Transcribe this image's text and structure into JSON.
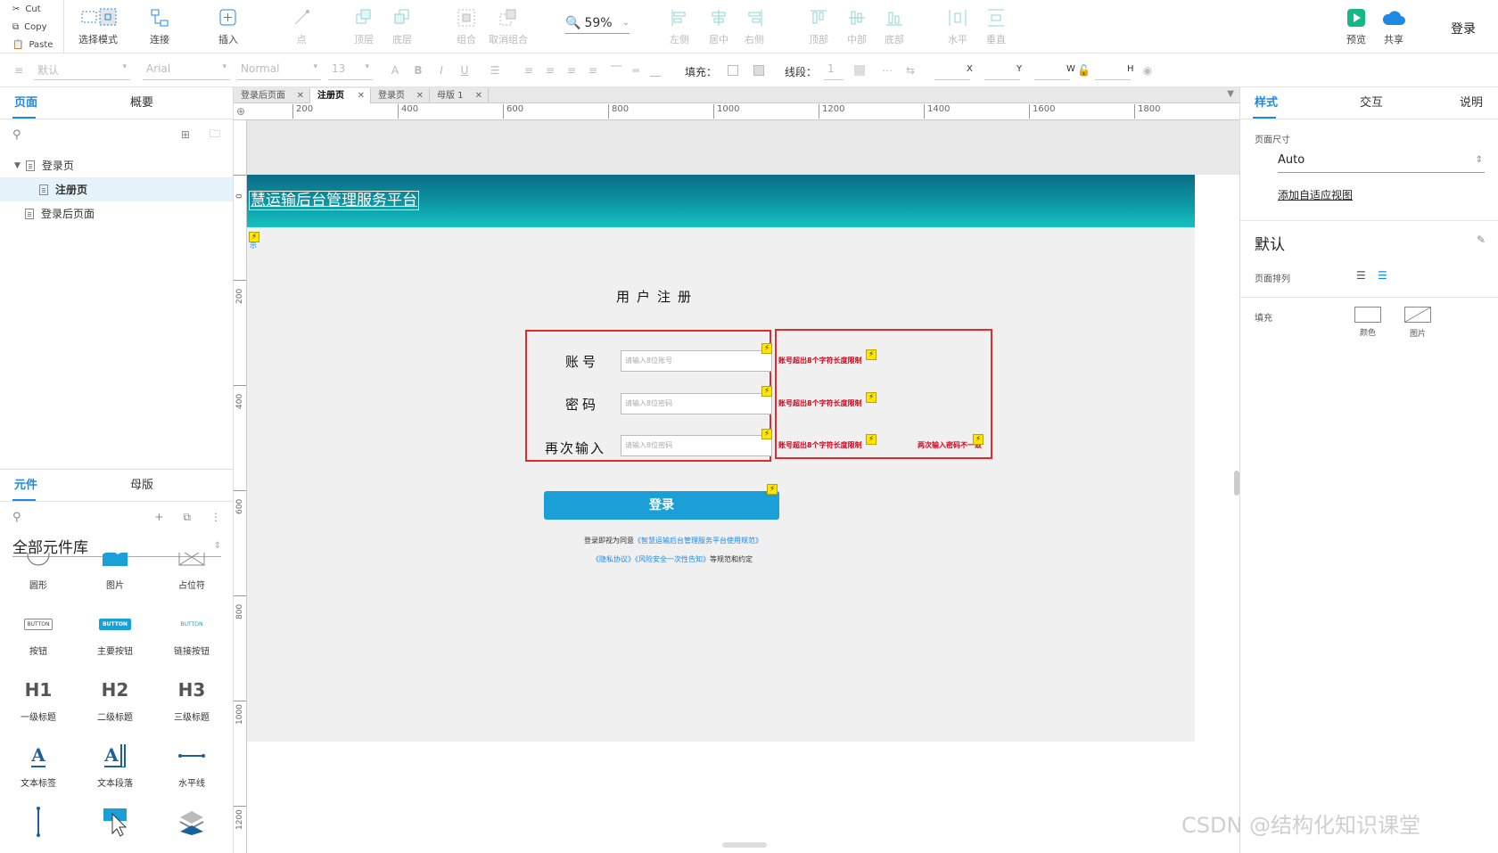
{
  "clipboard": {
    "cut": "Cut",
    "copy": "Copy",
    "paste": "Paste"
  },
  "toolbar": {
    "select_mode": "选择模式",
    "connect": "连接",
    "insert": "插入",
    "point": "点",
    "top_layer": "顶层",
    "bottom_layer": "底层",
    "group": "组合",
    "ungroup": "取消组合",
    "zoom": "59%",
    "align_left": "左侧",
    "align_center": "居中",
    "align_right": "右侧",
    "align_top": "顶部",
    "align_middle": "中部",
    "align_bottom": "底部",
    "dist_h": "水平",
    "dist_v": "垂直",
    "preview": "预览",
    "share": "共享",
    "login": "登录",
    "accent": "#1e88e5"
  },
  "format": {
    "style": "默认",
    "font": "Arial",
    "weight": "Normal",
    "size": "13",
    "fill_label": "填充：",
    "stroke_label": "线段：",
    "stroke_value": "1",
    "x": "X",
    "y": "Y",
    "w": "W",
    "h": "H"
  },
  "left_panel": {
    "tabs": [
      "页面",
      "概要"
    ],
    "pages": [
      {
        "label": "登录页",
        "level": 0,
        "selected": false
      },
      {
        "label": "注册页",
        "level": 1,
        "selected": true
      },
      {
        "label": "登录后页面",
        "level": 0,
        "selected": false
      }
    ],
    "lib_tabs": [
      "元件",
      "母版"
    ],
    "library_name": "全部元件库",
    "widgets": [
      {
        "label": "圆形",
        "icon": "circle-icon"
      },
      {
        "label": "图片",
        "icon": "image-icon"
      },
      {
        "label": "占位符",
        "icon": "placeholder-icon"
      },
      {
        "label": "按钮",
        "icon": "button-icon",
        "text": "BUTTON"
      },
      {
        "label": "主要按钮",
        "icon": "primary-button-icon",
        "text": "BUTTON"
      },
      {
        "label": "链接按钮",
        "icon": "link-button-icon",
        "text": "BUTTON"
      },
      {
        "label": "一级标题",
        "icon": "h1-icon",
        "text": "H1"
      },
      {
        "label": "二级标题",
        "icon": "h2-icon",
        "text": "H2"
      },
      {
        "label": "三级标题",
        "icon": "h3-icon",
        "text": "H3"
      },
      {
        "label": "文本标签",
        "icon": "text-label-icon",
        "text": "A"
      },
      {
        "label": "文本段落",
        "icon": "text-paragraph-icon",
        "text": "A"
      },
      {
        "label": "水平线",
        "icon": "horizontal-line-icon"
      }
    ]
  },
  "doc_tabs": [
    {
      "label": "登录后页面",
      "active": false
    },
    {
      "label": "注册页",
      "active": true
    },
    {
      "label": "登录页",
      "active": false
    },
    {
      "label": "母版 1",
      "active": false
    }
  ],
  "ruler": {
    "h": [
      "200",
      "400",
      "600",
      "800",
      "1000",
      "1200",
      "1400",
      "1600",
      "1800"
    ],
    "v": [
      "0",
      "200",
      "400",
      "600",
      "800",
      "1000",
      "1200"
    ]
  },
  "design": {
    "banner_title": "慧运输后台管理服务平台",
    "banner_link_char": "示",
    "form_title": "用户注册",
    "fields": [
      {
        "label": "账号",
        "placeholder": "请输入8位账号",
        "error": "账号超出8个字符长度限制"
      },
      {
        "label": "密码",
        "placeholder": "请输入8位密码",
        "error": "账号超出8个字符长度限制"
      },
      {
        "label": "再次输入",
        "placeholder": "请输入8位密码",
        "error": "账号超出8个字符长度限制",
        "error2": "两次输入密码不一致"
      }
    ],
    "button": "登录",
    "agree_prefix": "登录即视为同意",
    "agree_link1": "《智慧运输后台管理服务平台使用规范》",
    "agree_link2": "《隐私协议》《风险安全一次性告知》",
    "agree_suffix": "等规范和约定",
    "bolt": "⚡"
  },
  "right_panel": {
    "tabs": [
      "样式",
      "交互",
      "说明"
    ],
    "page_size_label": "页面尺寸",
    "page_size_value": "Auto",
    "adaptive_link": "添加自适应视图",
    "default_label": "默认",
    "page_align_label": "页面排列",
    "fill_label": "填充",
    "fill_color": "颜色",
    "fill_image": "图片"
  },
  "watermark": "CSDN @结构化知识课堂"
}
